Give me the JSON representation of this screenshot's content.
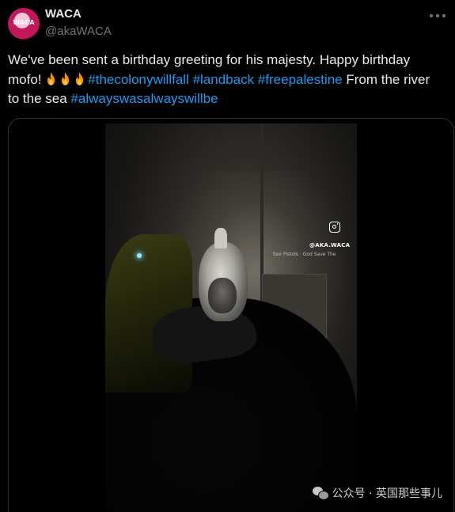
{
  "author": {
    "display_name": "WACA",
    "handle": "@akaWACA",
    "avatar_text": "WACA"
  },
  "tweet": {
    "text_lead": "We've been sent a birthday greeting for his majesty. Happy birthday mofo!",
    "emoji": "fire-icon x3",
    "hashtag_1": "#thecolonywillfall",
    "hashtag_2": "#landback",
    "hashtag_3": "#freepalestine",
    "text_mid": "From the river to the sea",
    "hashtag_4": "#alwayswasalwayswillbe"
  },
  "media": {
    "overlay_handle": "@AKA.WACA",
    "overlay_track": "Sex Pistols · God Save The"
  },
  "watermark": {
    "text": "公众号 · 英国那些事儿"
  },
  "colors": {
    "background": "#000000",
    "text": "#e7e9ea",
    "secondary": "#71767b",
    "link": "#1d9bf0"
  }
}
